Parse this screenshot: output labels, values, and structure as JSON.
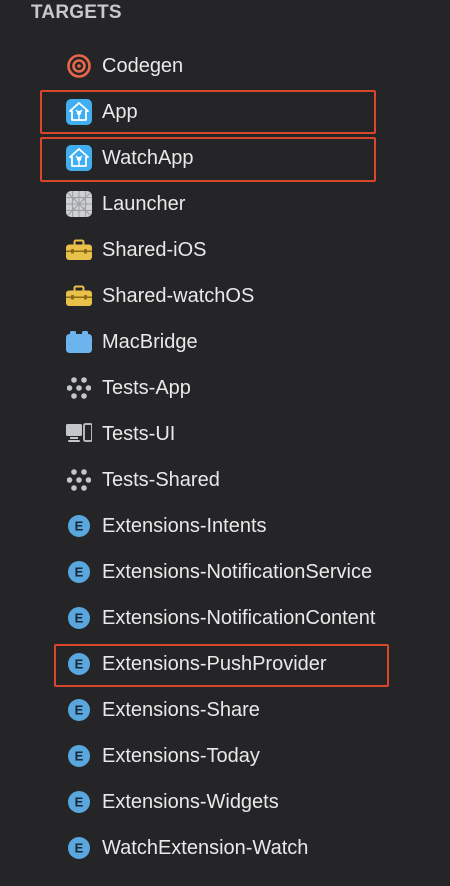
{
  "section": {
    "title": "TARGETS"
  },
  "targets": [
    {
      "label": "Codegen",
      "icon": "target-icon",
      "highlighted": false
    },
    {
      "label": "App",
      "icon": "app-icon",
      "highlighted": true
    },
    {
      "label": "WatchApp",
      "icon": "app-icon",
      "highlighted": true
    },
    {
      "label": "Launcher",
      "icon": "launcher-icon",
      "highlighted": false
    },
    {
      "label": "Shared-iOS",
      "icon": "toolbox-icon",
      "highlighted": false
    },
    {
      "label": "Shared-watchOS",
      "icon": "toolbox-icon",
      "highlighted": false
    },
    {
      "label": "MacBridge",
      "icon": "bundle-icon",
      "highlighted": false
    },
    {
      "label": "Tests-App",
      "icon": "unit-test-icon",
      "highlighted": false
    },
    {
      "label": "Tests-UI",
      "icon": "ui-test-icon",
      "highlighted": false
    },
    {
      "label": "Tests-Shared",
      "icon": "unit-test-icon",
      "highlighted": false
    },
    {
      "label": "Extensions-Intents",
      "icon": "extension-icon",
      "highlighted": false
    },
    {
      "label": "Extensions-NotificationService",
      "icon": "extension-icon",
      "highlighted": false
    },
    {
      "label": "Extensions-NotificationContent",
      "icon": "extension-icon",
      "highlighted": false
    },
    {
      "label": "Extensions-PushProvider",
      "icon": "extension-icon",
      "highlighted": true
    },
    {
      "label": "Extensions-Share",
      "icon": "extension-icon",
      "highlighted": false
    },
    {
      "label": "Extensions-Today",
      "icon": "extension-icon",
      "highlighted": false
    },
    {
      "label": "Extensions-Widgets",
      "icon": "extension-icon",
      "highlighted": false
    },
    {
      "label": "WatchExtension-Watch",
      "icon": "extension-icon",
      "highlighted": false
    }
  ],
  "colors": {
    "background": "#252528",
    "highlight_border": "#d8462b",
    "extension_icon": "#5aa7e0",
    "toolbox_icon": "#e8c04a",
    "app_icon": "#41aef0",
    "codegen_icon": "#e8674a"
  }
}
